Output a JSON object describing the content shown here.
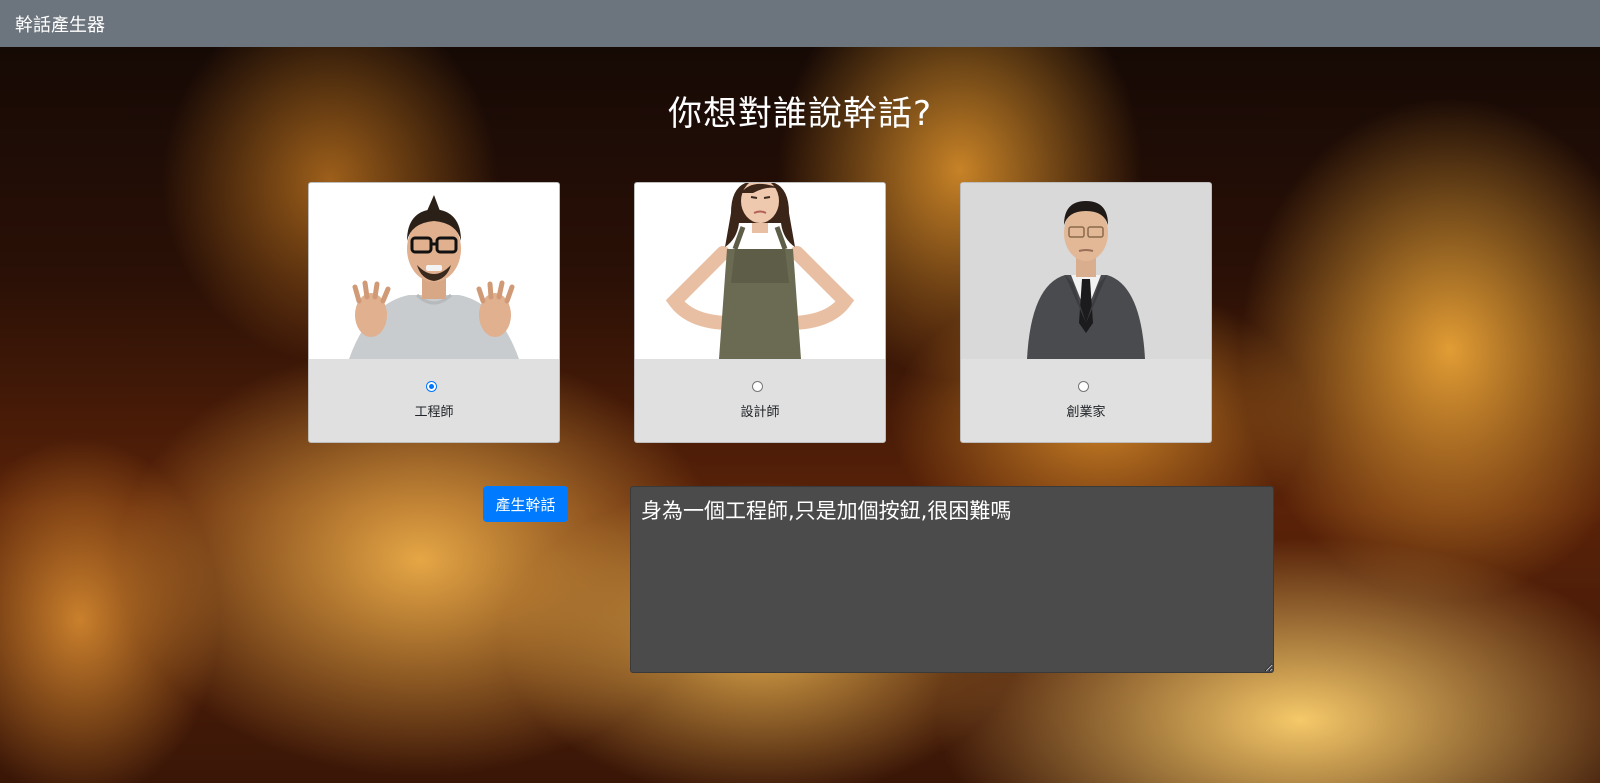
{
  "navbar": {
    "brand": "幹話產生器"
  },
  "main": {
    "headline": "你想對誰說幹話?",
    "options": [
      {
        "label": "工程師",
        "checked": true,
        "photo": "angry-engineer-photo"
      },
      {
        "label": "設計師",
        "checked": false,
        "photo": "annoyed-designer-photo"
      },
      {
        "label": "創業家",
        "checked": false,
        "photo": "suited-entrepreneur-photo"
      }
    ],
    "generate_button_label": "產生幹話",
    "output_text": "身為一個工程師,只是加個按鈕,很困難嗎"
  },
  "colors": {
    "navbar": "#6c757d",
    "button": "#007bff",
    "output_bg": "#4b4b4b",
    "card_bg": "#e0e0e0"
  }
}
